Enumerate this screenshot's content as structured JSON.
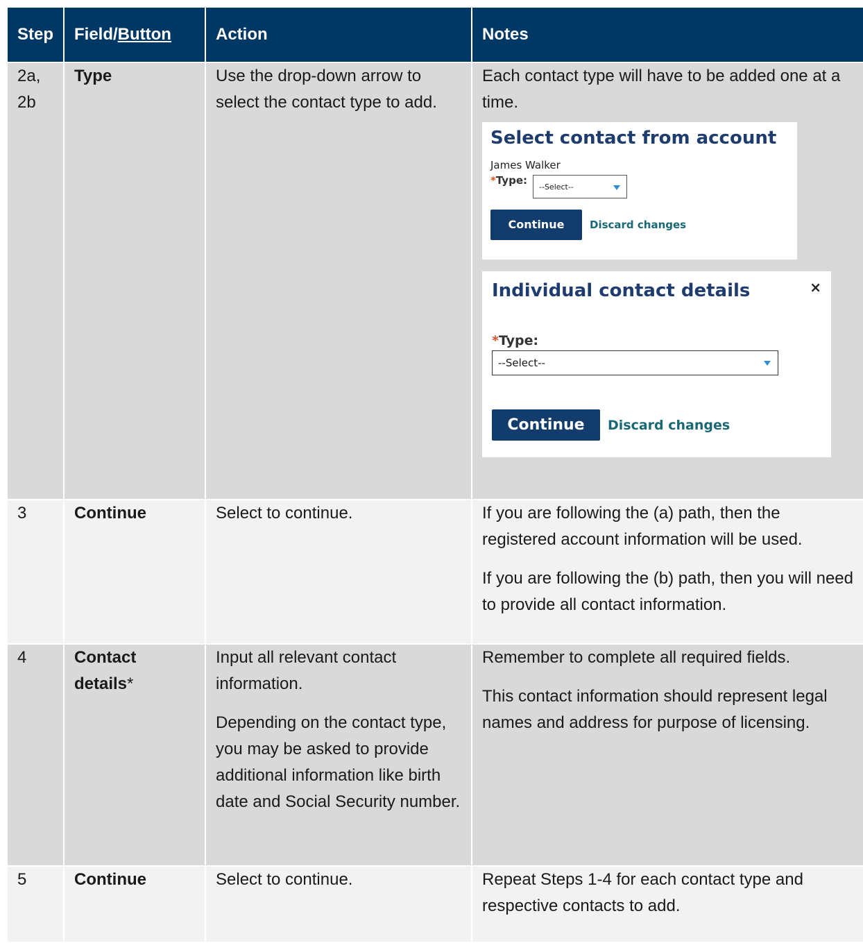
{
  "header": {
    "step": "Step",
    "field_prefix": "Field/",
    "field_underlined": "Button",
    "action": "Action",
    "notes": "Notes"
  },
  "rows": [
    {
      "step": "2a, 2b",
      "field": "Type",
      "action": "Use the drop-down arrow to select the contact type to add.",
      "notes": "Each contact type will have to be added one at a time."
    },
    {
      "step": "3",
      "field": "Continue",
      "action": "Select to continue.",
      "notes": [
        "If you are following the (a) path, then the registered account information will be used.",
        "If you are following the (b) path, then you will need to provide all contact information."
      ]
    },
    {
      "step": "4",
      "field": "Contact details",
      "field_suffix": "*",
      "action": [
        "Input all relevant contact information.",
        "Depending on the contact type, you may be asked to provide additional information like birth date and Social Security number."
      ],
      "notes": [
        "Remember to complete all required fields.",
        "This contact information should represent legal names and address for purpose of licensing."
      ]
    },
    {
      "step": "5",
      "field": "Continue",
      "action": "Select to continue.",
      "notes": "Repeat Steps 1-4 for each contact type and respective contacts to add."
    }
  ],
  "screenshot1": {
    "title": "Select contact from account",
    "contact_name": "James Walker",
    "required_mark": "*",
    "type_label": "Type:",
    "select_value": "--Select--",
    "continue_label": "Continue",
    "discard_label": "Discard changes"
  },
  "screenshot2": {
    "title": "Individual contact details",
    "close_glyph": "×",
    "required_mark": "*",
    "type_label": "Type:",
    "select_value": "--Select--",
    "continue_label": "Continue",
    "discard_label": "Discard changes"
  },
  "colors": {
    "header_bg": "#003865",
    "row_dark": "#d9d9d9",
    "row_light": "#f2f2f2",
    "button_bg": "#123c6b",
    "link": "#196874",
    "required": "#d9532b"
  }
}
